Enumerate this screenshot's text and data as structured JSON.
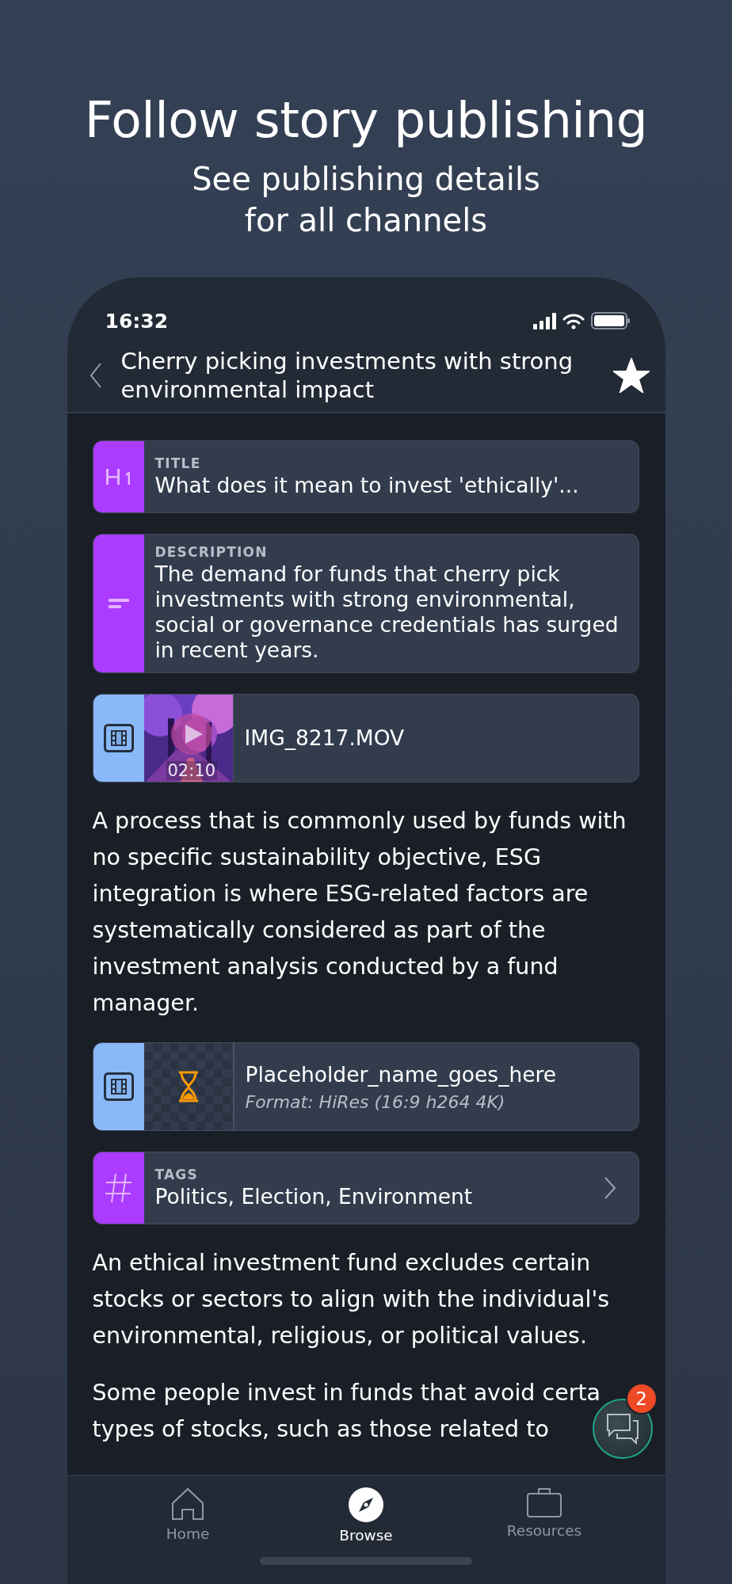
{
  "headline": {
    "title": "Follow story publishing",
    "subtitle_lines": [
      "See publishing details",
      "for all channels"
    ]
  },
  "status_bar": {
    "time": "16:32"
  },
  "header": {
    "title": "Cherry picking investments with strong environmental impact",
    "favorite": true
  },
  "blocks": [
    {
      "kind": "title",
      "label": "TITLE",
      "value": "What does it mean to invest 'ethically'..."
    },
    {
      "kind": "description",
      "label": "DESCRIPTION",
      "value": "The demand for funds that cherry pick investments with strong environmental, social or governance credentials has surged in recent years."
    },
    {
      "kind": "video",
      "duration": "02:10",
      "name": "IMG_8217.MOV"
    },
    {
      "kind": "paragraph",
      "text": "A process that is commonly used by funds with no specific sustainability objective, ESG integration is where ESG-related factors are systematically considered as part of the investment analysis conducted by a fund manager."
    },
    {
      "kind": "pending",
      "name": "Placeholder_name_goes_here",
      "format": "Format: HiRes (16:9 h264 4K)"
    },
    {
      "kind": "tags",
      "label": "TAGS",
      "value": "Politics, Election, Environment"
    },
    {
      "kind": "paragraph",
      "text": "An ethical investment fund excludes certain stocks or sectors to align with the individual's environmental, religious, or political values."
    },
    {
      "kind": "lines",
      "lines": [
        "Some people invest in funds that avoid certa",
        "types of stocks, such as those related to"
      ]
    }
  ],
  "chat": {
    "badge": "2"
  },
  "tabs": [
    {
      "label": "Home",
      "selected": false
    },
    {
      "label": "Browse",
      "selected": true
    },
    {
      "label": "Resources",
      "selected": false
    }
  ]
}
